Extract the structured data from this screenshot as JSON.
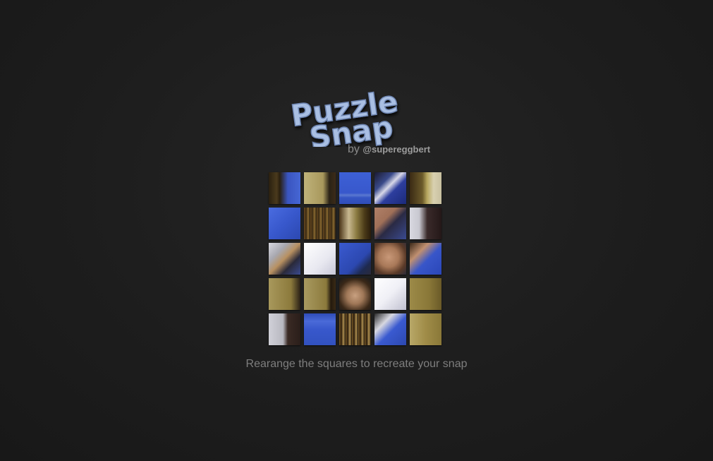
{
  "header": {
    "title_line1": "Puzzle",
    "title_line2": "Snap",
    "by_label": "by",
    "author_handle": "@supereggbert"
  },
  "instruction": "Rearange the squares to recreate your snap",
  "colors": {
    "background": "#1c1c1c",
    "logo_fill": "#a9bfe3",
    "logo_stroke": "#6d84b0",
    "shirt_blue": "#3856c9",
    "door_tan": "#8c7a3c",
    "wall_white": "#d4d4dc",
    "shelf_brown": "#3a2a14",
    "skin": "#a8785a"
  },
  "board": {
    "rows": 5,
    "cols": 5,
    "tiles": [
      {
        "style": "doorframe-blue"
      },
      {
        "style": "door-tan"
      },
      {
        "style": "shirt-print"
      },
      {
        "style": "chair-blue"
      },
      {
        "style": "shelf-corner"
      },
      {
        "style": "shirt-blue"
      },
      {
        "style": "bookshelf"
      },
      {
        "style": "shelf-items"
      },
      {
        "style": "arm-chair"
      },
      {
        "style": "wall-dark"
      },
      {
        "style": "chair-corner"
      },
      {
        "style": "white-wall"
      },
      {
        "style": "shirt-blue-dark"
      },
      {
        "style": "face-glasses"
      },
      {
        "style": "arm-blue"
      },
      {
        "style": "door-hinge"
      },
      {
        "style": "door-edge"
      },
      {
        "style": "face-forehead"
      },
      {
        "style": "white-light"
      },
      {
        "style": "door-tan-dark"
      },
      {
        "style": "wall-post"
      },
      {
        "style": "shirt-print-low"
      },
      {
        "style": "bookshelf-low"
      },
      {
        "style": "shoulder-blue"
      },
      {
        "style": "door-tan-light"
      }
    ]
  }
}
